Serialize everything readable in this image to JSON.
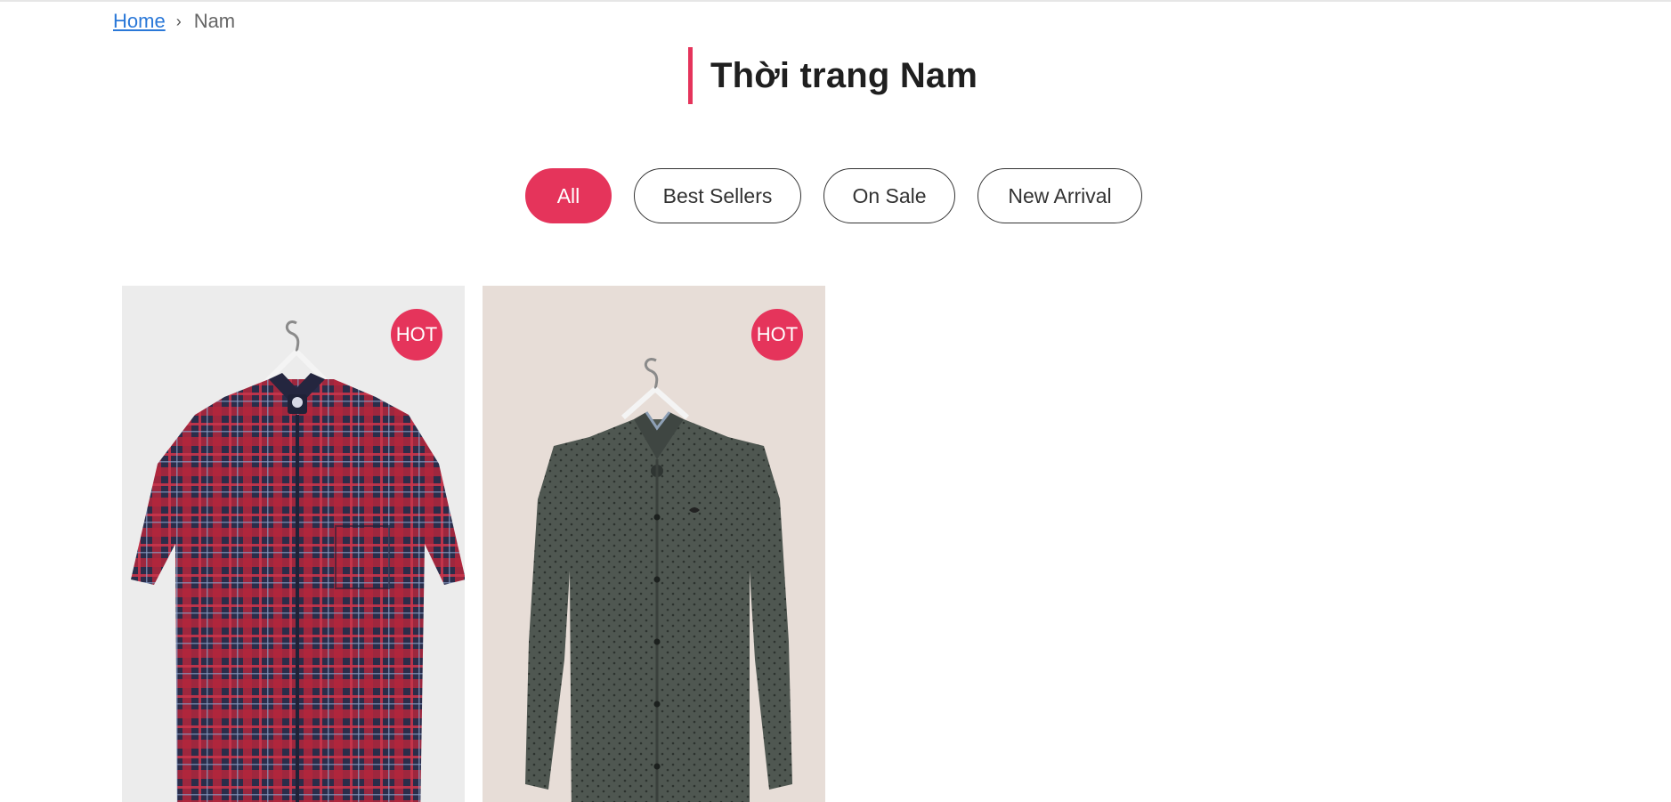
{
  "breadcrumb": {
    "home": "Home",
    "separator": "›",
    "current": "Nam"
  },
  "page": {
    "title": "Thời trang Nam"
  },
  "filters": [
    {
      "label": "All",
      "active": true
    },
    {
      "label": "Best Sellers",
      "active": false
    },
    {
      "label": "On Sale",
      "active": false
    },
    {
      "label": "New Arrival",
      "active": false
    }
  ],
  "products": [
    {
      "badge": "HOT",
      "image_icon": "plaid-short-sleeve-shirt-image"
    },
    {
      "badge": "HOT",
      "image_icon": "gray-long-sleeve-shirt-image"
    }
  ],
  "colors": {
    "accent": "#e5345b",
    "link": "#2a78d8"
  }
}
